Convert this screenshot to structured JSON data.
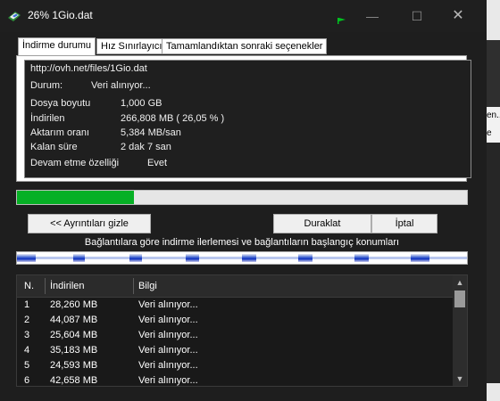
{
  "window": {
    "title": "26% 1Gio.dat",
    "icon": "idm-download-icon",
    "flag_icon": "green-flag-icon",
    "controls": {
      "minimize": "—",
      "maximize": "☐",
      "close": "✕"
    }
  },
  "tabs": [
    {
      "label": "İndirme durumu",
      "active": true
    },
    {
      "label": "Hız Sınırlayıcı",
      "active": false
    },
    {
      "label": "Tamamlandıktan sonraki seçenekler",
      "active": false
    }
  ],
  "status": {
    "url": "http://ovh.net/files/1Gio.dat",
    "state_label": "Durum:",
    "state_value": "Veri alınıyor...",
    "size_label": "Dosya boyutu",
    "size_value": "1,000  GB",
    "downloaded_label": "İndirilen",
    "downloaded_value": "266,808  MB  ( 26,05 % )",
    "rate_label": "Aktarım oranı",
    "rate_value": "5,384  MB/san",
    "remaining_label": "Kalan süre",
    "remaining_value": "2 dak 7 san",
    "resume_label": "Devam etme özelliği",
    "resume_value": "Evet"
  },
  "progress": {
    "fraction": 0.2605,
    "color": "#06b025"
  },
  "buttons": {
    "details": "<< Ayrıntıları gizle",
    "pause": "Duraklat",
    "cancel": "İptal"
  },
  "connections_caption": "Bağlantılara göre indirme ilerlemesi ve bağlantıların başlangıç konumları",
  "connections": [
    {
      "start": 0.0,
      "progress": 0.041
    },
    {
      "start": 0.125,
      "progress": 0.025
    },
    {
      "start": 0.25,
      "progress": 0.027
    },
    {
      "start": 0.375,
      "progress": 0.029
    },
    {
      "start": 0.5,
      "progress": 0.031
    },
    {
      "start": 0.625,
      "progress": 0.031
    },
    {
      "start": 0.75,
      "progress": 0.031
    },
    {
      "start": 0.875,
      "progress": 0.041
    }
  ],
  "table": {
    "headers": [
      "N.",
      "İndirilen",
      "Bilgi"
    ],
    "rows": [
      [
        "1",
        "28,260  MB",
        "Veri alınıyor..."
      ],
      [
        "2",
        "44,087  MB",
        "Veri alınıyor..."
      ],
      [
        "3",
        "25,604  MB",
        "Veri alınıyor..."
      ],
      [
        "4",
        "35,183  MB",
        "Veri alınıyor..."
      ],
      [
        "5",
        "24,593  MB",
        "Veri alınıyor..."
      ],
      [
        "6",
        "42,658  MB",
        "Veri alınıyor..."
      ]
    ]
  },
  "background_window": {
    "snippet_1": "en..",
    "snippet_2": "e"
  }
}
